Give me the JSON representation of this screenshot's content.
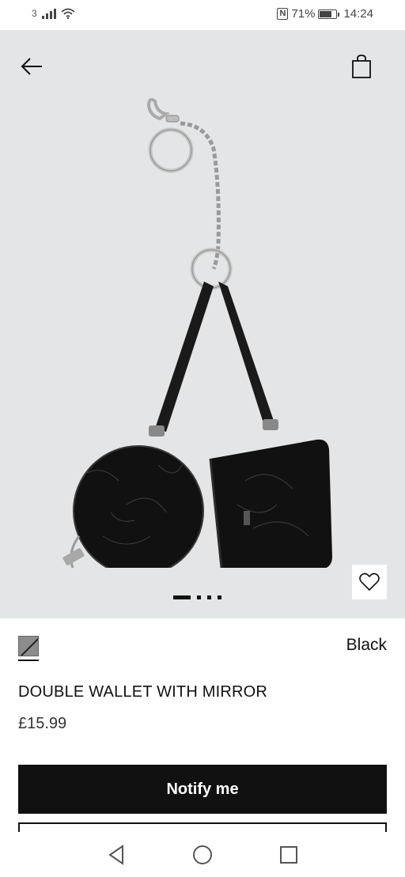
{
  "status_bar": {
    "sim_label": "3",
    "nfc_label": "N",
    "battery_percent": "71%",
    "battery_level": 0.71,
    "time": "14:24"
  },
  "gallery": {
    "image_count": 4,
    "active_index": 0,
    "background_color": "#e3e5e6"
  },
  "icons": {
    "back": "back-arrow-icon",
    "bag": "shopping-bag-icon",
    "favorite": "heart-icon"
  },
  "product": {
    "color_name": "Black",
    "title": "DOUBLE WALLET WITH MIRROR",
    "price": "£15.99"
  },
  "actions": {
    "notify_label": "Notify me"
  },
  "colors": {
    "primary_button": "#111111",
    "primary_button_text": "#ffffff"
  }
}
